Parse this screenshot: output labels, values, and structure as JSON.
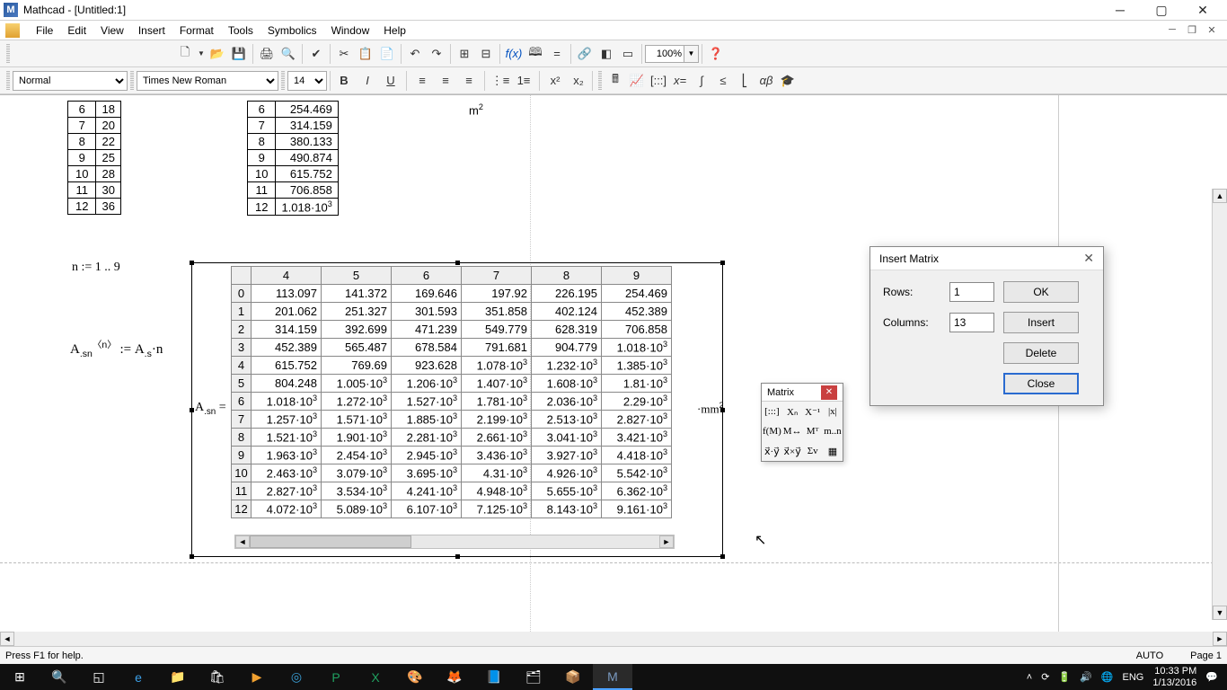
{
  "window": {
    "app_icon_letter": "M",
    "title": "Mathcad - [Untitled:1]"
  },
  "menus": [
    "File",
    "Edit",
    "View",
    "Insert",
    "Format",
    "Tools",
    "Symbolics",
    "Window",
    "Help"
  ],
  "toolbar1_zoom": "100%",
  "format_bar": {
    "style": "Normal",
    "font": "Times New Roman",
    "size": "14"
  },
  "small_table_left": [
    [
      "6",
      "18"
    ],
    [
      "7",
      "20"
    ],
    [
      "8",
      "22"
    ],
    [
      "9",
      "25"
    ],
    [
      "10",
      "28"
    ],
    [
      "11",
      "30"
    ],
    [
      "12",
      "36"
    ]
  ],
  "small_table_right": [
    [
      "6",
      "254.469"
    ],
    [
      "7",
      "314.159"
    ],
    [
      "8",
      "380.133"
    ],
    [
      "9",
      "490.874"
    ],
    [
      "10",
      "615.752"
    ],
    [
      "11",
      "706.858"
    ],
    [
      "12",
      "1.018·10^3"
    ]
  ],
  "top_unit": "m",
  "top_unit_exp": "2",
  "range_def": "n := 1 .. 9",
  "assign_def_html": "A<sub>.sn</sub><sup>〈n〉</sup> := A<sub>.s</sub>·n",
  "result_label_html": "A<sub>.sn</sub> =",
  "result_unit_html": "·mm<sup>2</sup>",
  "result_headers": [
    "4",
    "5",
    "6",
    "7",
    "8",
    "9"
  ],
  "result_rows": [
    {
      "i": "0",
      "v": [
        "113.097",
        "141.372",
        "169.646",
        "197.92",
        "226.195",
        "254.469"
      ]
    },
    {
      "i": "1",
      "v": [
        "201.062",
        "251.327",
        "301.593",
        "351.858",
        "402.124",
        "452.389"
      ]
    },
    {
      "i": "2",
      "v": [
        "314.159",
        "392.699",
        "471.239",
        "549.779",
        "628.319",
        "706.858"
      ]
    },
    {
      "i": "3",
      "v": [
        "452.389",
        "565.487",
        "678.584",
        "791.681",
        "904.779",
        "1.018·10^3"
      ]
    },
    {
      "i": "4",
      "v": [
        "615.752",
        "769.69",
        "923.628",
        "1.078·10^3",
        "1.232·10^3",
        "1.385·10^3"
      ]
    },
    {
      "i": "5",
      "v": [
        "804.248",
        "1.005·10^3",
        "1.206·10^3",
        "1.407·10^3",
        "1.608·10^3",
        "1.81·10^3"
      ]
    },
    {
      "i": "6",
      "v": [
        "1.018·10^3",
        "1.272·10^3",
        "1.527·10^3",
        "1.781·10^3",
        "2.036·10^3",
        "2.29·10^3"
      ]
    },
    {
      "i": "7",
      "v": [
        "1.257·10^3",
        "1.571·10^3",
        "1.885·10^3",
        "2.199·10^3",
        "2.513·10^3",
        "2.827·10^3"
      ]
    },
    {
      "i": "8",
      "v": [
        "1.521·10^3",
        "1.901·10^3",
        "2.281·10^3",
        "2.661·10^3",
        "3.041·10^3",
        "3.421·10^3"
      ]
    },
    {
      "i": "9",
      "v": [
        "1.963·10^3",
        "2.454·10^3",
        "2.945·10^3",
        "3.436·10^3",
        "3.927·10^3",
        "4.418·10^3"
      ]
    },
    {
      "i": "10",
      "v": [
        "2.463·10^3",
        "3.079·10^3",
        "3.695·10^3",
        "4.31·10^3",
        "4.926·10^3",
        "5.542·10^3"
      ]
    },
    {
      "i": "11",
      "v": [
        "2.827·10^3",
        "3.534·10^3",
        "4.241·10^3",
        "4.948·10^3",
        "5.655·10^3",
        "6.362·10^3"
      ]
    },
    {
      "i": "12",
      "v": [
        "4.072·10^3",
        "5.089·10^3",
        "6.107·10^3",
        "7.125·10^3",
        "8.143·10^3",
        "9.161·10^3"
      ]
    }
  ],
  "matrix_palette": {
    "title": "Matrix",
    "buttons": [
      "[:::]",
      "Xₙ",
      "X⁻¹",
      "|x|",
      "f(M)",
      "M↔",
      "Mᵀ",
      "m..n",
      "x⃗·y⃗",
      "x⃗×y⃗",
      "Σv",
      "▦"
    ]
  },
  "dialog": {
    "title": "Insert Matrix",
    "rows_label": "Rows:",
    "cols_label": "Columns:",
    "rows_value": "1",
    "cols_value": "13",
    "ok": "OK",
    "insert": "Insert",
    "delete": "Delete",
    "close": "Close"
  },
  "status": {
    "left": "Press F1 for help.",
    "auto": "AUTO",
    "page": "Page 1"
  },
  "tray": {
    "lang": "ENG",
    "time": "10:33 PM",
    "date": "1/13/2016"
  }
}
